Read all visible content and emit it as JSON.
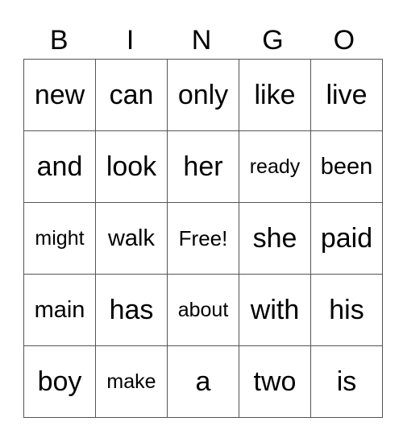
{
  "header": [
    "B",
    "I",
    "N",
    "G",
    "O"
  ],
  "rows": [
    [
      "new",
      "can",
      "only",
      "like",
      "live"
    ],
    [
      "and",
      "look",
      "her",
      "ready",
      "been"
    ],
    [
      "might",
      "walk",
      "Free!",
      "she",
      "paid"
    ],
    [
      "main",
      "has",
      "about",
      "with",
      "his"
    ],
    [
      "boy",
      "make",
      "a",
      "two",
      "is"
    ]
  ]
}
